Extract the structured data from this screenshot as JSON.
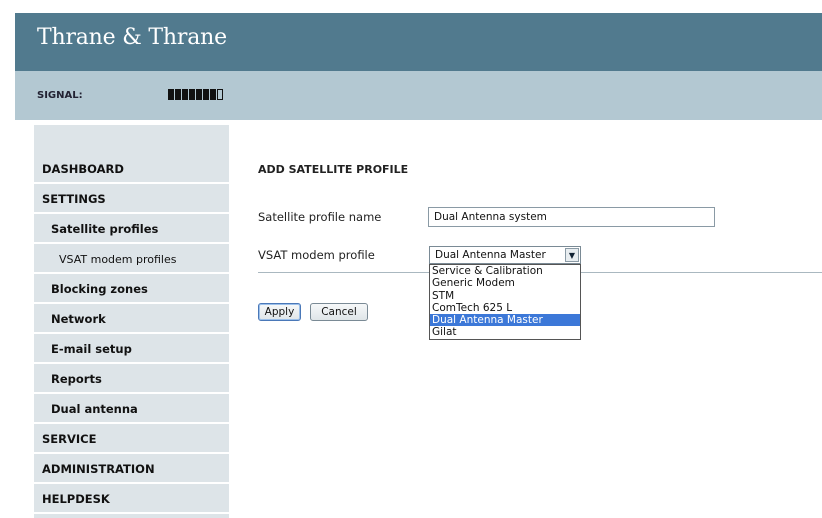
{
  "header": {
    "brand": "Thrane & Thrane",
    "signal_label": "SIGNAL:",
    "signal_level": {
      "filled_bars": 7,
      "total_bars": 8
    }
  },
  "sidebar": {
    "items": [
      {
        "label": "DASHBOARD",
        "level": 0
      },
      {
        "label": "SETTINGS",
        "level": 0
      },
      {
        "label": "Satellite profiles",
        "level": 1
      },
      {
        "label": "VSAT modem profiles",
        "level": 2
      },
      {
        "label": "Blocking zones",
        "level": 1
      },
      {
        "label": "Network",
        "level": 1
      },
      {
        "label": "E-mail setup",
        "level": 1
      },
      {
        "label": "Reports",
        "level": 1
      },
      {
        "label": "Dual antenna",
        "level": 1
      },
      {
        "label": "SERVICE",
        "level": 0
      },
      {
        "label": "ADMINISTRATION",
        "level": 0
      },
      {
        "label": "HELPDESK",
        "level": 0
      }
    ]
  },
  "form": {
    "title": "ADD SATELLITE PROFILE",
    "profile_name_label": "Satellite profile name",
    "profile_name_value": "Dual Antenna system",
    "modem_profile_label": "VSAT modem profile",
    "modem_profile_selected": "Dual Antenna Master",
    "modem_profile_options": [
      "Service & Calibration",
      "Generic Modem",
      "STM",
      "ComTech 625 L",
      "Dual Antenna Master",
      "Gilat"
    ],
    "apply_label": "Apply",
    "cancel_label": "Cancel"
  },
  "colors": {
    "brand_bar": "#517a8e",
    "signal_bar": "#b3c8d2",
    "sidebar": "#dde4e8",
    "selected_option": "#3c78d8"
  }
}
